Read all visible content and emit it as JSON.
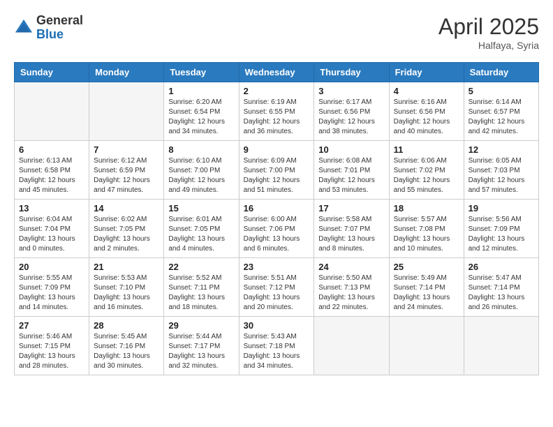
{
  "header": {
    "logo_general": "General",
    "logo_blue": "Blue",
    "month_year": "April 2025",
    "location": "Halfaya, Syria"
  },
  "calendar": {
    "days_of_week": [
      "Sunday",
      "Monday",
      "Tuesday",
      "Wednesday",
      "Thursday",
      "Friday",
      "Saturday"
    ],
    "weeks": [
      [
        {
          "day": "",
          "empty": true
        },
        {
          "day": "",
          "empty": true
        },
        {
          "day": "1",
          "sunrise": "Sunrise: 6:20 AM",
          "sunset": "Sunset: 6:54 PM",
          "daylight": "Daylight: 12 hours and 34 minutes."
        },
        {
          "day": "2",
          "sunrise": "Sunrise: 6:19 AM",
          "sunset": "Sunset: 6:55 PM",
          "daylight": "Daylight: 12 hours and 36 minutes."
        },
        {
          "day": "3",
          "sunrise": "Sunrise: 6:17 AM",
          "sunset": "Sunset: 6:56 PM",
          "daylight": "Daylight: 12 hours and 38 minutes."
        },
        {
          "day": "4",
          "sunrise": "Sunrise: 6:16 AM",
          "sunset": "Sunset: 6:56 PM",
          "daylight": "Daylight: 12 hours and 40 minutes."
        },
        {
          "day": "5",
          "sunrise": "Sunrise: 6:14 AM",
          "sunset": "Sunset: 6:57 PM",
          "daylight": "Daylight: 12 hours and 42 minutes."
        }
      ],
      [
        {
          "day": "6",
          "sunrise": "Sunrise: 6:13 AM",
          "sunset": "Sunset: 6:58 PM",
          "daylight": "Daylight: 12 hours and 45 minutes."
        },
        {
          "day": "7",
          "sunrise": "Sunrise: 6:12 AM",
          "sunset": "Sunset: 6:59 PM",
          "daylight": "Daylight: 12 hours and 47 minutes."
        },
        {
          "day": "8",
          "sunrise": "Sunrise: 6:10 AM",
          "sunset": "Sunset: 7:00 PM",
          "daylight": "Daylight: 12 hours and 49 minutes."
        },
        {
          "day": "9",
          "sunrise": "Sunrise: 6:09 AM",
          "sunset": "Sunset: 7:00 PM",
          "daylight": "Daylight: 12 hours and 51 minutes."
        },
        {
          "day": "10",
          "sunrise": "Sunrise: 6:08 AM",
          "sunset": "Sunset: 7:01 PM",
          "daylight": "Daylight: 12 hours and 53 minutes."
        },
        {
          "day": "11",
          "sunrise": "Sunrise: 6:06 AM",
          "sunset": "Sunset: 7:02 PM",
          "daylight": "Daylight: 12 hours and 55 minutes."
        },
        {
          "day": "12",
          "sunrise": "Sunrise: 6:05 AM",
          "sunset": "Sunset: 7:03 PM",
          "daylight": "Daylight: 12 hours and 57 minutes."
        }
      ],
      [
        {
          "day": "13",
          "sunrise": "Sunrise: 6:04 AM",
          "sunset": "Sunset: 7:04 PM",
          "daylight": "Daylight: 13 hours and 0 minutes."
        },
        {
          "day": "14",
          "sunrise": "Sunrise: 6:02 AM",
          "sunset": "Sunset: 7:05 PM",
          "daylight": "Daylight: 13 hours and 2 minutes."
        },
        {
          "day": "15",
          "sunrise": "Sunrise: 6:01 AM",
          "sunset": "Sunset: 7:05 PM",
          "daylight": "Daylight: 13 hours and 4 minutes."
        },
        {
          "day": "16",
          "sunrise": "Sunrise: 6:00 AM",
          "sunset": "Sunset: 7:06 PM",
          "daylight": "Daylight: 13 hours and 6 minutes."
        },
        {
          "day": "17",
          "sunrise": "Sunrise: 5:58 AM",
          "sunset": "Sunset: 7:07 PM",
          "daylight": "Daylight: 13 hours and 8 minutes."
        },
        {
          "day": "18",
          "sunrise": "Sunrise: 5:57 AM",
          "sunset": "Sunset: 7:08 PM",
          "daylight": "Daylight: 13 hours and 10 minutes."
        },
        {
          "day": "19",
          "sunrise": "Sunrise: 5:56 AM",
          "sunset": "Sunset: 7:09 PM",
          "daylight": "Daylight: 13 hours and 12 minutes."
        }
      ],
      [
        {
          "day": "20",
          "sunrise": "Sunrise: 5:55 AM",
          "sunset": "Sunset: 7:09 PM",
          "daylight": "Daylight: 13 hours and 14 minutes."
        },
        {
          "day": "21",
          "sunrise": "Sunrise: 5:53 AM",
          "sunset": "Sunset: 7:10 PM",
          "daylight": "Daylight: 13 hours and 16 minutes."
        },
        {
          "day": "22",
          "sunrise": "Sunrise: 5:52 AM",
          "sunset": "Sunset: 7:11 PM",
          "daylight": "Daylight: 13 hours and 18 minutes."
        },
        {
          "day": "23",
          "sunrise": "Sunrise: 5:51 AM",
          "sunset": "Sunset: 7:12 PM",
          "daylight": "Daylight: 13 hours and 20 minutes."
        },
        {
          "day": "24",
          "sunrise": "Sunrise: 5:50 AM",
          "sunset": "Sunset: 7:13 PM",
          "daylight": "Daylight: 13 hours and 22 minutes."
        },
        {
          "day": "25",
          "sunrise": "Sunrise: 5:49 AM",
          "sunset": "Sunset: 7:14 PM",
          "daylight": "Daylight: 13 hours and 24 minutes."
        },
        {
          "day": "26",
          "sunrise": "Sunrise: 5:47 AM",
          "sunset": "Sunset: 7:14 PM",
          "daylight": "Daylight: 13 hours and 26 minutes."
        }
      ],
      [
        {
          "day": "27",
          "sunrise": "Sunrise: 5:46 AM",
          "sunset": "Sunset: 7:15 PM",
          "daylight": "Daylight: 13 hours and 28 minutes."
        },
        {
          "day": "28",
          "sunrise": "Sunrise: 5:45 AM",
          "sunset": "Sunset: 7:16 PM",
          "daylight": "Daylight: 13 hours and 30 minutes."
        },
        {
          "day": "29",
          "sunrise": "Sunrise: 5:44 AM",
          "sunset": "Sunset: 7:17 PM",
          "daylight": "Daylight: 13 hours and 32 minutes."
        },
        {
          "day": "30",
          "sunrise": "Sunrise: 5:43 AM",
          "sunset": "Sunset: 7:18 PM",
          "daylight": "Daylight: 13 hours and 34 minutes."
        },
        {
          "day": "",
          "empty": true
        },
        {
          "day": "",
          "empty": true
        },
        {
          "day": "",
          "empty": true
        }
      ]
    ]
  }
}
